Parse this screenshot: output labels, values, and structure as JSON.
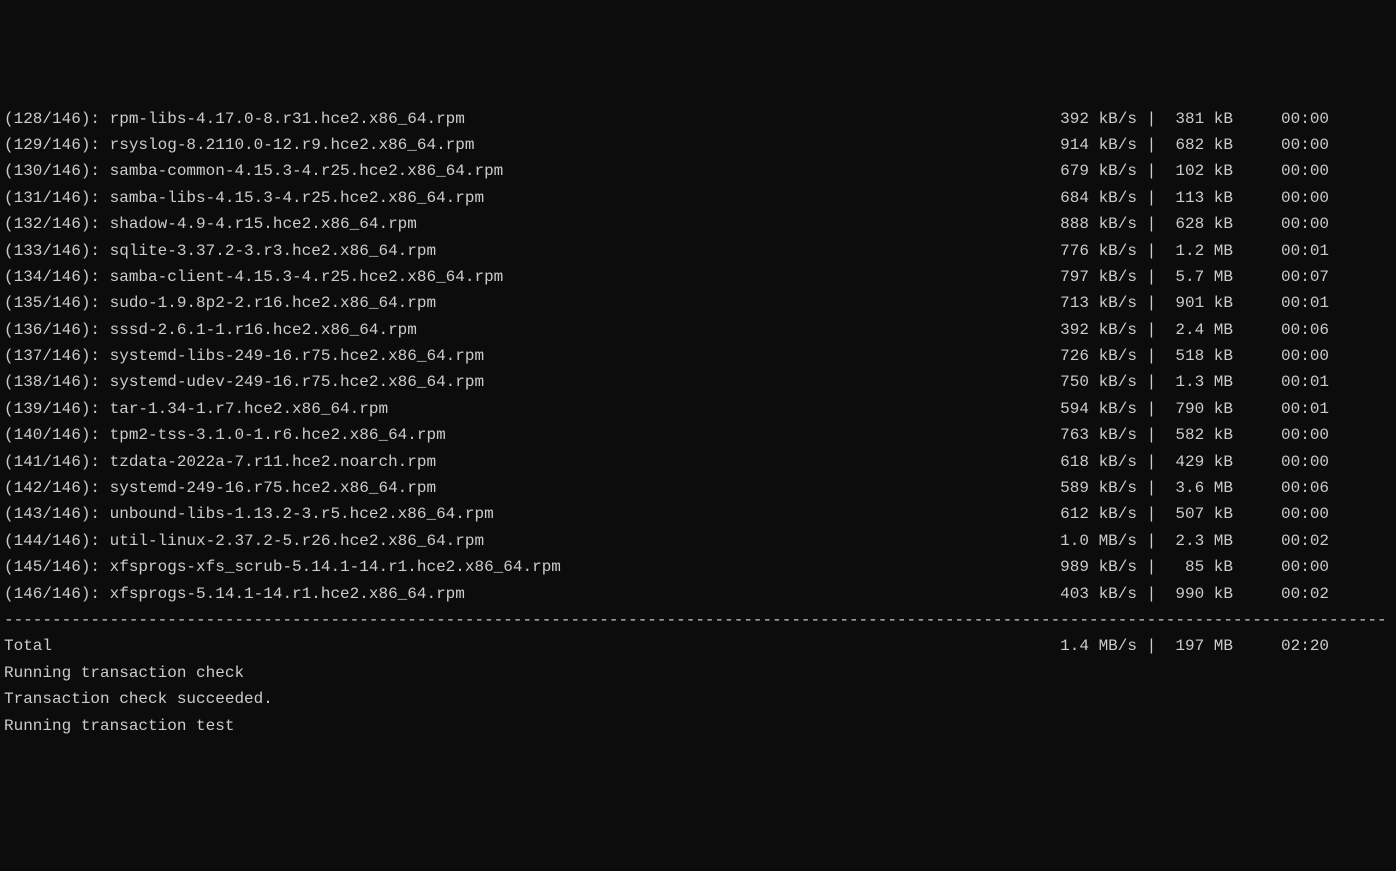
{
  "downloads": [
    {
      "index": "(128/146):",
      "filename": "rpm-libs-4.17.0-8.r31.hce2.x86_64.rpm",
      "speed": "392 kB/s",
      "size": "381 kB",
      "time": "00:00"
    },
    {
      "index": "(129/146):",
      "filename": "rsyslog-8.2110.0-12.r9.hce2.x86_64.rpm",
      "speed": "914 kB/s",
      "size": "682 kB",
      "time": "00:00"
    },
    {
      "index": "(130/146):",
      "filename": "samba-common-4.15.3-4.r25.hce2.x86_64.rpm",
      "speed": "679 kB/s",
      "size": "102 kB",
      "time": "00:00"
    },
    {
      "index": "(131/146):",
      "filename": "samba-libs-4.15.3-4.r25.hce2.x86_64.rpm",
      "speed": "684 kB/s",
      "size": "113 kB",
      "time": "00:00"
    },
    {
      "index": "(132/146):",
      "filename": "shadow-4.9-4.r15.hce2.x86_64.rpm",
      "speed": "888 kB/s",
      "size": "628 kB",
      "time": "00:00"
    },
    {
      "index": "(133/146):",
      "filename": "sqlite-3.37.2-3.r3.hce2.x86_64.rpm",
      "speed": "776 kB/s",
      "size": "1.2 MB",
      "time": "00:01"
    },
    {
      "index": "(134/146):",
      "filename": "samba-client-4.15.3-4.r25.hce2.x86_64.rpm",
      "speed": "797 kB/s",
      "size": "5.7 MB",
      "time": "00:07"
    },
    {
      "index": "(135/146):",
      "filename": "sudo-1.9.8p2-2.r16.hce2.x86_64.rpm",
      "speed": "713 kB/s",
      "size": "901 kB",
      "time": "00:01"
    },
    {
      "index": "(136/146):",
      "filename": "sssd-2.6.1-1.r16.hce2.x86_64.rpm",
      "speed": "392 kB/s",
      "size": "2.4 MB",
      "time": "00:06"
    },
    {
      "index": "(137/146):",
      "filename": "systemd-libs-249-16.r75.hce2.x86_64.rpm",
      "speed": "726 kB/s",
      "size": "518 kB",
      "time": "00:00"
    },
    {
      "index": "(138/146):",
      "filename": "systemd-udev-249-16.r75.hce2.x86_64.rpm",
      "speed": "750 kB/s",
      "size": "1.3 MB",
      "time": "00:01"
    },
    {
      "index": "(139/146):",
      "filename": "tar-1.34-1.r7.hce2.x86_64.rpm",
      "speed": "594 kB/s",
      "size": "790 kB",
      "time": "00:01"
    },
    {
      "index": "(140/146):",
      "filename": "tpm2-tss-3.1.0-1.r6.hce2.x86_64.rpm",
      "speed": "763 kB/s",
      "size": "582 kB",
      "time": "00:00"
    },
    {
      "index": "(141/146):",
      "filename": "tzdata-2022a-7.r11.hce2.noarch.rpm",
      "speed": "618 kB/s",
      "size": "429 kB",
      "time": "00:00"
    },
    {
      "index": "(142/146):",
      "filename": "systemd-249-16.r75.hce2.x86_64.rpm",
      "speed": "589 kB/s",
      "size": "3.6 MB",
      "time": "00:06"
    },
    {
      "index": "(143/146):",
      "filename": "unbound-libs-1.13.2-3.r5.hce2.x86_64.rpm",
      "speed": "612 kB/s",
      "size": "507 kB",
      "time": "00:00"
    },
    {
      "index": "(144/146):",
      "filename": "util-linux-2.37.2-5.r26.hce2.x86_64.rpm",
      "speed": "1.0 MB/s",
      "size": "2.3 MB",
      "time": "00:02"
    },
    {
      "index": "(145/146):",
      "filename": "xfsprogs-xfs_scrub-5.14.1-14.r1.hce2.x86_64.rpm",
      "speed": "989 kB/s",
      "size": " 85 kB",
      "time": "00:00"
    },
    {
      "index": "(146/146):",
      "filename": "xfsprogs-5.14.1-14.r1.hce2.x86_64.rpm",
      "speed": "403 kB/s",
      "size": "990 kB",
      "time": "00:02"
    }
  ],
  "total": {
    "label": "Total",
    "speed": "1.4 MB/s",
    "size": "197 MB",
    "time": "02:20"
  },
  "status_lines": [
    "Running transaction check",
    "Transaction check succeeded.",
    "Running transaction test"
  ],
  "layout": {
    "filename_col_width": 109,
    "speed_col_width": 9,
    "size_col_width": 7,
    "separator_char": "-",
    "total_width": 144
  }
}
